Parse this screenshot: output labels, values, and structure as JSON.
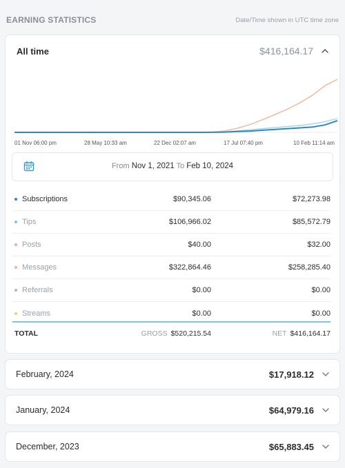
{
  "header": {
    "title": "EARNING STATISTICS",
    "timezone_note": "Date/Time shown in UTC time zone"
  },
  "summary": {
    "period_label": "All time",
    "total": "$416,164.17"
  },
  "chart_data": {
    "type": "line",
    "x_ticks": [
      "01 Nov 06:00 pm",
      "28 May 10:33 am",
      "22 Dec 02:07 am",
      "17 Jul 07:40 pm",
      "10 Feb 11:14 am"
    ],
    "series": [
      {
        "color": "#f2b59a",
        "values": [
          0,
          0,
          0,
          0,
          0,
          0,
          0,
          0,
          0,
          0,
          0,
          0,
          0,
          0,
          0,
          0,
          0.5,
          3,
          8,
          15,
          24,
          34,
          44,
          56,
          70,
          88,
          100
        ]
      },
      {
        "color": "#9fd6ef",
        "values": [
          0,
          0,
          0,
          0,
          0,
          0,
          0,
          0,
          0,
          0,
          0,
          0,
          0,
          0,
          0,
          0,
          0.2,
          1,
          3,
          5,
          7,
          9,
          11,
          13,
          16,
          20,
          26
        ]
      },
      {
        "color": "#2e86c1",
        "values": [
          0,
          0,
          0,
          0,
          0,
          0,
          0,
          0,
          0,
          0,
          0,
          0,
          0,
          0,
          0,
          0,
          0.1,
          0.5,
          1.5,
          2.5,
          4,
          5.5,
          7,
          8.5,
          10,
          14,
          22
        ]
      }
    ]
  },
  "range": {
    "from_label": "From",
    "from_date": "Nov 1, 2021",
    "to_label": "To",
    "to_date": "Feb 10, 2024"
  },
  "rows": [
    {
      "name": "Subscriptions",
      "color": "#2e86c1",
      "gross": "$90,345.06",
      "net": "$72,273.98",
      "dark": true
    },
    {
      "name": "Tips",
      "color": "#7fc4e8",
      "gross": "$106,966.02",
      "net": "$85,572.79",
      "dark": false
    },
    {
      "name": "Posts",
      "color": "#f2a8a8",
      "gross": "$40.00",
      "net": "$32.00",
      "dark": false
    },
    {
      "name": "Messages",
      "color": "#f2b59a",
      "gross": "$322,864.46",
      "net": "$258,285.40",
      "dark": false
    },
    {
      "name": "Referrals",
      "color": "#b0b6bd",
      "gross": "$0.00",
      "net": "$0.00",
      "dark": false
    },
    {
      "name": "Streams",
      "color": "#e8d27a",
      "gross": "$0.00",
      "net": "$0.00",
      "dark": false
    }
  ],
  "totals": {
    "label": "TOTAL",
    "gross_caption": "GROSS",
    "gross": "$520,215.54",
    "net_caption": "NET",
    "net": "$416,164.17"
  },
  "months": [
    {
      "label": "February, 2024",
      "value": "$17,918.12"
    },
    {
      "label": "January, 2024",
      "value": "$64,979.16"
    },
    {
      "label": "December, 2023",
      "value": "$65,883.45"
    }
  ]
}
